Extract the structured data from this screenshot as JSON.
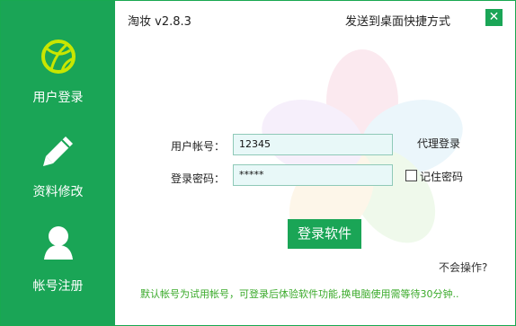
{
  "colors": {
    "accent": "#1aa556",
    "icon_yellow_green": "#c8e600",
    "notice_green": "#3aaa2a"
  },
  "titlebar": {
    "app_title": "淘妆 v2.8.3",
    "shortcut_label": "发送到桌面快捷方式",
    "close_icon": "close-icon"
  },
  "sidebar": {
    "items": [
      {
        "label": "用户登录",
        "icon": "basketball-icon"
      },
      {
        "label": "资料修改",
        "icon": "pencil-icon"
      },
      {
        "label": "帐号注册",
        "icon": "user-icon"
      }
    ]
  },
  "form": {
    "account_label": "用户帐号：",
    "account_value": "12345",
    "password_label": "登录密码：",
    "password_value": "*****",
    "agent_login": "代理登录",
    "remember_label": "记住密码",
    "login_button": "登录软件",
    "help_link": "不会操作?"
  },
  "notice": "默认帐号为试用帐号，可登录后体验软件功能,换电脑使用需等待30分钟.."
}
